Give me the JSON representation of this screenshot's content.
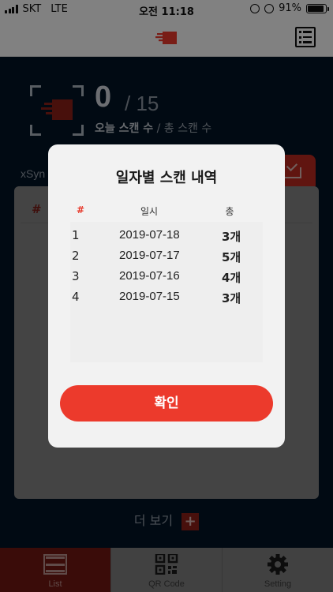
{
  "status_bar": {
    "carrier": "SKT",
    "network": "LTE",
    "time": "오전 11:18",
    "battery": "91%",
    "battery_level": 0.91
  },
  "icons": {
    "logo": "scan-logo-icon",
    "list": "list-icon",
    "qr": "qr-code-icon",
    "settings": "gear-icon",
    "export": "export-tray-icon"
  },
  "colors": {
    "accent": "#ec3a2c",
    "dark_background": "#031426",
    "modal_background": "#f2f2f2",
    "header_hash": "#e8392b"
  },
  "summary": {
    "today_count": "0",
    "total_count": "/ 15",
    "today_label": "오늘 스캔 수",
    "total_label": "/ 총 스캔 수",
    "sync_label": "xSyn"
  },
  "list_panel": {
    "hash_header": "#"
  },
  "more": {
    "label": "더 보기",
    "plus": "+"
  },
  "tabs": [
    {
      "label": "List",
      "active": true
    },
    {
      "label": "QR Code",
      "active": false
    },
    {
      "label": "Setting",
      "active": false
    }
  ],
  "modal": {
    "title": "일자별 스캔 내역",
    "headers": {
      "num": "#",
      "date": "일시",
      "total": "총"
    },
    "rows": [
      {
        "num": "1",
        "date": "2019-07-18",
        "total": "3개"
      },
      {
        "num": "2",
        "date": "2019-07-17",
        "total": "5개"
      },
      {
        "num": "3",
        "date": "2019-07-16",
        "total": "4개"
      },
      {
        "num": "4",
        "date": "2019-07-15",
        "total": "3개"
      }
    ],
    "confirm_label": "확인"
  }
}
